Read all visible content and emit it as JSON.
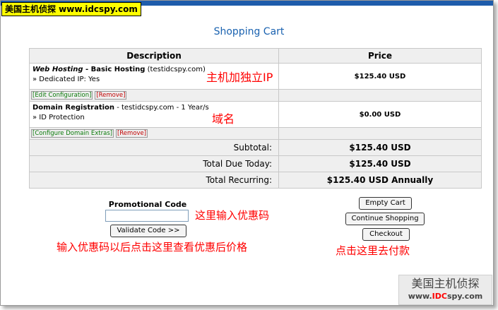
{
  "watermark_top": "美国主机侦探 www.idcspy.com",
  "page_title": "Shopping Cart",
  "table": {
    "col_description": "Description",
    "col_price": "Price"
  },
  "items": [
    {
      "name_italic": "Web Hosting",
      "name_rest": " - Basic Hosting",
      "domain": " (testidcspy.com)",
      "sub": "» Dedicated IP: Yes",
      "price": "$125.40 USD",
      "link1": "[Edit Configuration]",
      "link2": "[Remove]"
    },
    {
      "name_bold": "Domain Registration",
      "detail": " - testidcspy.com - 1 Year/s",
      "sub": "» ID Protection",
      "price": "$0.00 USD",
      "link1": "[Configure Domain Extras]",
      "link2": "[Remove]"
    }
  ],
  "totals": [
    {
      "label": "Subtotal:",
      "value": "$125.40 USD"
    },
    {
      "label": "Total Due Today:",
      "value": "$125.40 USD"
    },
    {
      "label": "Total Recurring:",
      "value": "$125.40 USD Annually"
    }
  ],
  "annotations": {
    "hosting": "主机加独立IP",
    "domain": "域名",
    "promo_input": "这里输入优惠码",
    "promo_validate": "输入优惠码以后点击这里查看优惠后价格",
    "checkout": "点击这里去付款"
  },
  "promo": {
    "label": "Promotional Code",
    "value": "",
    "validate_button": "Validate Code >>"
  },
  "buttons": {
    "empty_cart": "Empty Cart",
    "continue_shopping": "Continue Shopping",
    "checkout": "Checkout"
  },
  "watermark_bottom": {
    "line1": "美国主机侦探",
    "line2_prefix": "www.",
    "line2_brand": "IDC",
    "line2_suffix": "spy.com"
  }
}
